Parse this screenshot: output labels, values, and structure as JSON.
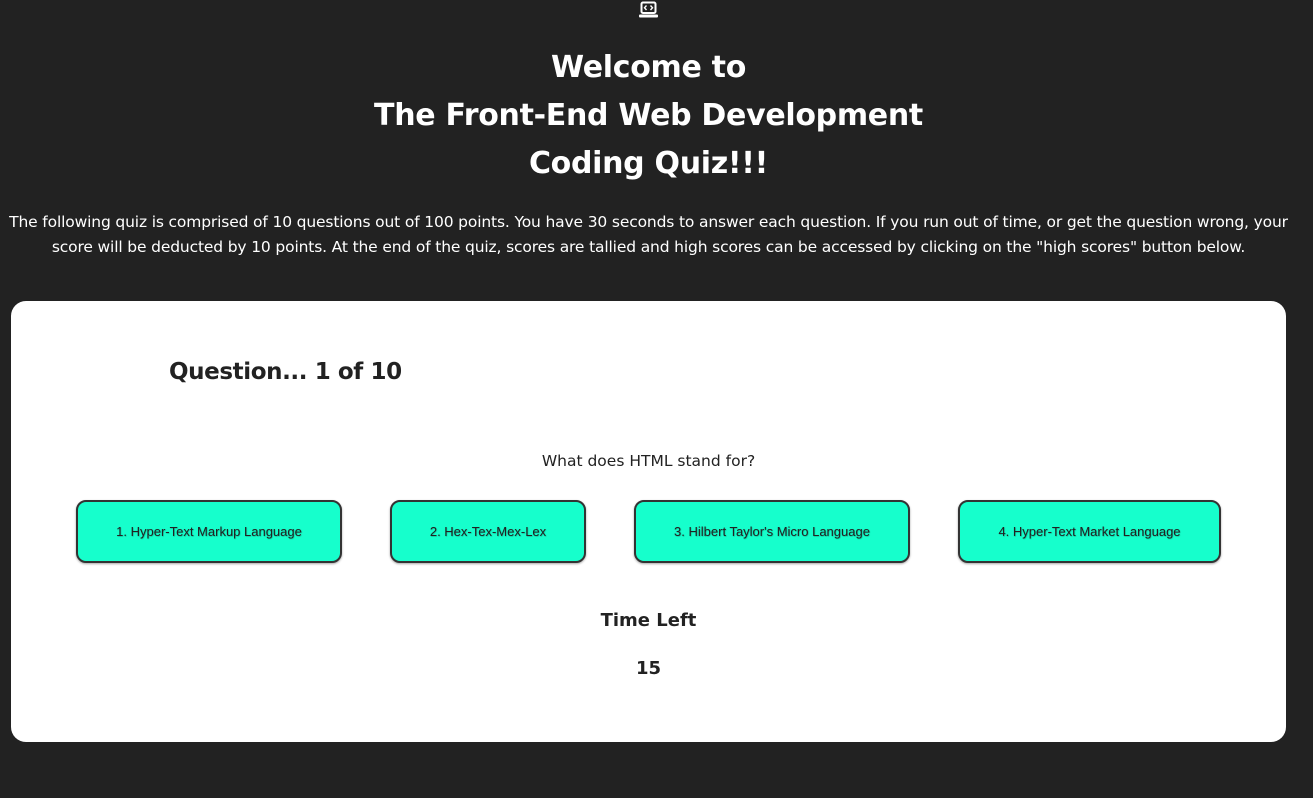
{
  "header": {
    "icon": "laptop-code-icon",
    "title_lines": [
      "Welcome to",
      "The Front-End Web Development",
      "Coding Quiz!!!"
    ]
  },
  "intro": {
    "text": "The following quiz is comprised of 10 questions out of 100 points. You have 30 seconds to answer each question. If you run out of time, or get the question wrong, your score will be deducted by 10 points. At the end of the quiz, scores are tallied and high scores can be accessed by clicking on the \"high scores\" button below."
  },
  "quiz": {
    "question_number": "Question... 1 of 10",
    "question_text": "What does HTML stand for?",
    "answers": [
      "1. Hyper-Text Markup Language",
      "2. Hex-Tex-Mex-Lex",
      "3. Hilbert Taylor's Micro Language",
      "4. Hyper-Text Market Language"
    ],
    "time_label": "Time Left",
    "time_value": "15"
  },
  "colors": {
    "background": "#222222",
    "card": "#ffffff",
    "answer_button": "#16ffcc",
    "text_dark": "#222222"
  }
}
